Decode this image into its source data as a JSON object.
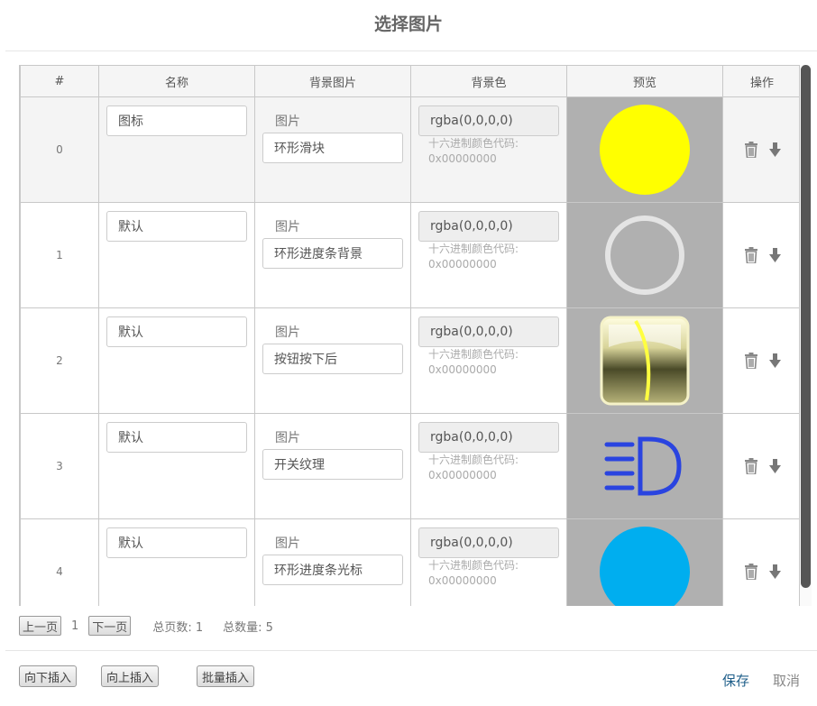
{
  "dialog": {
    "title": "选择图片"
  },
  "table": {
    "headers": {
      "index": "#",
      "name": "名称",
      "bg_image": "背景图片",
      "bg_color": "背景色",
      "preview": "预览",
      "actions": "操作"
    },
    "rows": [
      {
        "index": "0",
        "name": "图标",
        "bg_image_label": "图片",
        "bg_image": "环形滑块",
        "bg_color": "rgba(0,0,0,0)",
        "hex_label": "十六进制颜色代码:",
        "hex_value": "0x00000000",
        "preview_icon": "yellow-circle-icon",
        "selected": true
      },
      {
        "index": "1",
        "name": "默认",
        "bg_image_label": "图片",
        "bg_image": "环形进度条背景",
        "bg_color": "rgba(0,0,0,0)",
        "hex_label": "十六进制颜色代码:",
        "hex_value": "0x00000000",
        "preview_icon": "ring-icon",
        "selected": false
      },
      {
        "index": "2",
        "name": "默认",
        "bg_image_label": "图片",
        "bg_image": "按钮按下后",
        "bg_color": "rgba(0,0,0,0)",
        "hex_label": "十六进制颜色代码:",
        "hex_value": "0x00000000",
        "preview_icon": "glossy-button-icon",
        "selected": false
      },
      {
        "index": "3",
        "name": "默认",
        "bg_image_label": "图片",
        "bg_image": "开关纹理",
        "bg_color": "rgba(0,0,0,0)",
        "hex_label": "十六进制颜色代码:",
        "hex_value": "0x00000000",
        "preview_icon": "headlight-icon",
        "selected": false
      },
      {
        "index": "4",
        "name": "默认",
        "bg_image_label": "图片",
        "bg_image": "环形进度条光标",
        "bg_color": "rgba(0,0,0,0)",
        "hex_label": "十六进制颜色代码:",
        "hex_value": "0x00000000",
        "preview_icon": "blue-circle-icon",
        "selected": false
      }
    ],
    "action_icons": [
      "trash-icon",
      "arrow-down-icon"
    ]
  },
  "pager": {
    "prev": "上一页",
    "current": "1",
    "next": "下一页",
    "total_pages": "总页数: 1",
    "total_count": "总数量: 5"
  },
  "footer": {
    "insert_below": "向下插入",
    "insert_above": "向上插入",
    "batch_insert": "批量插入",
    "save": "保存",
    "cancel": "取消"
  },
  "colors": {
    "preview_bg": "#b0b0b0",
    "yellow": "#ffff00",
    "blue": "#00aeef",
    "headlight": "#2a44e0",
    "save_link": "#1f5f8a"
  }
}
